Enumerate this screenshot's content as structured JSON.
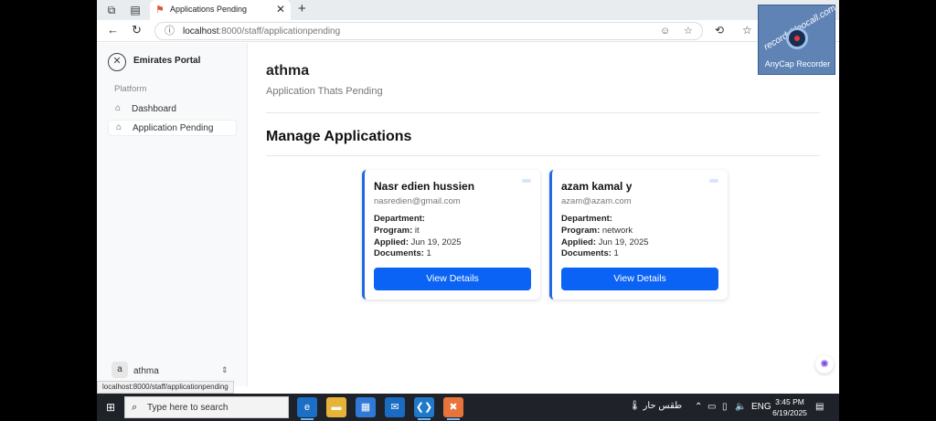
{
  "browser": {
    "tab_title": "Applications Pending",
    "url_host": "localhost",
    "url_path": ":8000/staff/applicationpending",
    "status_url": "localhost:8000/staff/applicationpending"
  },
  "sidebar": {
    "brand": "Emirates Portal",
    "section_label": "Platform",
    "items": [
      {
        "label": "Dashboard",
        "active": false
      },
      {
        "label": "Application Pending",
        "active": true
      }
    ],
    "user": {
      "initial": "a",
      "name": "athma"
    }
  },
  "main": {
    "title": "athma",
    "subtitle": "Application Thats Pending",
    "section_title": "Manage Applications",
    "cards": [
      {
        "name": "Nasr edien hussien",
        "email": "nasredien@gmail.com",
        "department_label": "Department:",
        "department": "",
        "program_label": "Program:",
        "program": "it",
        "applied_label": "Applied:",
        "applied": "Jun 19, 2025",
        "documents_label": "Documents:",
        "documents": "1",
        "button": "View Details"
      },
      {
        "name": "azam kamal y",
        "email": "azam@azam.com",
        "department_label": "Department:",
        "department": "",
        "program_label": "Program:",
        "program": "network",
        "applied_label": "Applied:",
        "applied": "Jun 19, 2025",
        "documents_label": "Documents:",
        "documents": "1",
        "button": "View Details"
      }
    ]
  },
  "watermark": {
    "site": "recordvideocall.com",
    "label": "AnyCap Recorder"
  },
  "taskbar": {
    "search_placeholder": "Type here to search",
    "weather": "طقس حار",
    "language": "ENG",
    "time": "3:45 PM",
    "date": "6/19/2025"
  },
  "colors": {
    "accent": "#0b63f6",
    "card_border": "#2169e6"
  }
}
